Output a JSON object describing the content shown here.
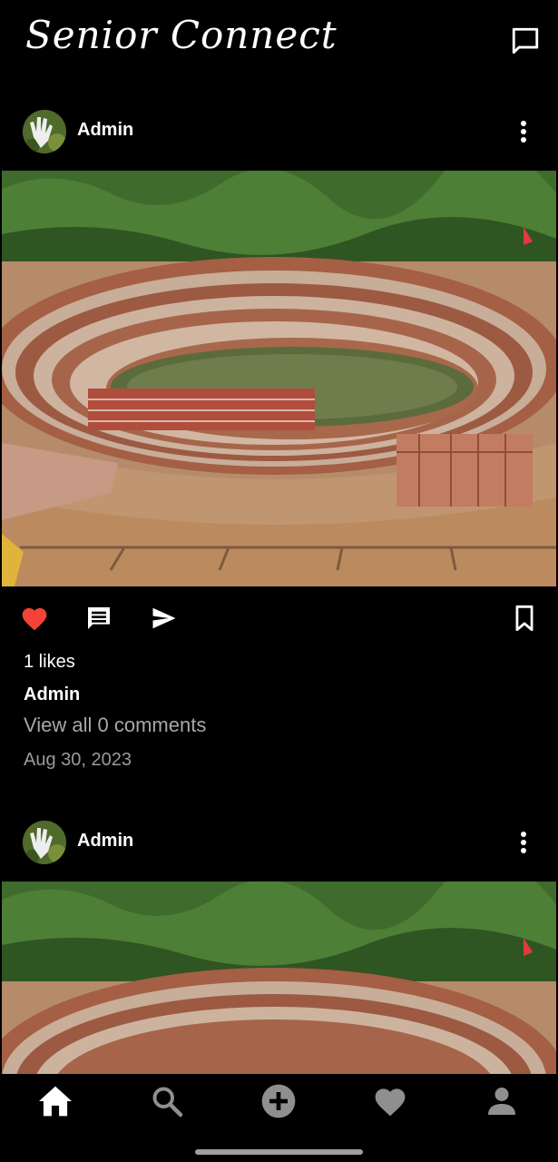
{
  "header": {
    "brand": "Senior Connect",
    "message_icon": "chat-bubble-icon"
  },
  "posts": [
    {
      "author": "Admin",
      "likes": "1 likes",
      "caption_author": "Admin",
      "view_comments": "View all 0 comments",
      "date": "Aug 30, 2023",
      "liked": true
    },
    {
      "author": "Admin"
    }
  ],
  "colors": {
    "background": "#000000",
    "text": "#ffffff",
    "muted": "#a7a7a7",
    "like_red": "#f44336",
    "nav_inactive": "#8f8f8f"
  },
  "bottom_nav": [
    {
      "name": "home",
      "icon": "home-icon",
      "active": true
    },
    {
      "name": "search",
      "icon": "search-icon",
      "active": false
    },
    {
      "name": "add-post",
      "icon": "add-circle-icon",
      "active": false
    },
    {
      "name": "activity",
      "icon": "heart-icon",
      "active": false
    },
    {
      "name": "profile",
      "icon": "person-icon",
      "active": false
    }
  ]
}
